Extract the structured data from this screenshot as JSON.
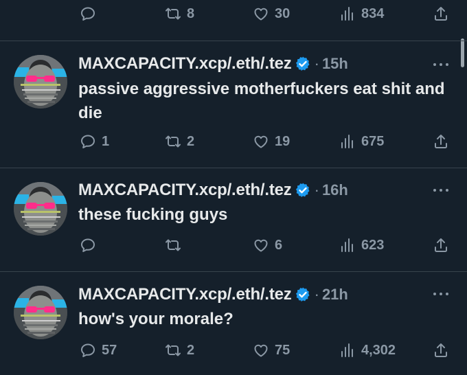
{
  "top_actions": {
    "reply_count": "",
    "retweet_count": "8",
    "like_count": "30",
    "view_count": "834"
  },
  "tweets": [
    {
      "author": "MAXCAPACITY.xcp/.eth/.tez",
      "separator": "·",
      "time": "15h",
      "text": "passive aggressive motherfuckers eat shit and die",
      "reply_count": "1",
      "retweet_count": "2",
      "like_count": "19",
      "view_count": "675"
    },
    {
      "author": "MAXCAPACITY.xcp/.eth/.tez",
      "separator": "·",
      "time": "16h",
      "text": "these fucking guys",
      "reply_count": "",
      "retweet_count": "",
      "like_count": "6",
      "view_count": "623"
    },
    {
      "author": "MAXCAPACITY.xcp/.eth/.tez",
      "separator": "·",
      "time": "21h",
      "text": "how's your morale?",
      "reply_count": "57",
      "retweet_count": "2",
      "like_count": "75",
      "view_count": "4,302"
    }
  ],
  "icons": {
    "reply": "speech-bubble-icon",
    "retweet": "retweet-arrows-icon",
    "like": "heart-icon",
    "views": "bar-chart-icon",
    "share": "upload-arrow-icon",
    "verified": "verified-badge-icon",
    "more": "ellipsis-icon"
  },
  "colors": {
    "background": "#15202b",
    "text": "#e7e9ea",
    "secondary": "#8b98a5",
    "divider": "#38444d",
    "verified": "#1d9bf0"
  }
}
